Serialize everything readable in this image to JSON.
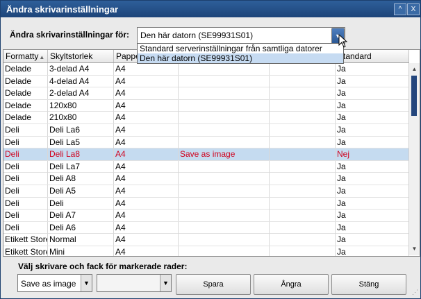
{
  "window": {
    "title": "Ändra skrivarinställningar"
  },
  "titlebar": {
    "minimize_glyph": "^",
    "close_glyph": "X"
  },
  "filter": {
    "label": "Ändra skrivarinställningar för:",
    "selected": "Den här datorn (SE99931S01)",
    "options": [
      "Standard serverinställningar från samtliga datorer",
      "Den här datorn (SE99931S01)"
    ]
  },
  "table": {
    "columns": [
      "Formatty",
      "Skyltstorlek",
      "Papper",
      "",
      "",
      "Standard"
    ],
    "sort_glyph": "▲",
    "rows": [
      [
        "Delade",
        "3-delad A4",
        "A4",
        "",
        "",
        "Ja"
      ],
      [
        "Delade",
        "4-delad A4",
        "A4",
        "",
        "",
        "Ja"
      ],
      [
        "Delade",
        "2-delad A4",
        "A4",
        "",
        "",
        "Ja"
      ],
      [
        "Delade",
        "120x80",
        "A4",
        "",
        "",
        "Ja"
      ],
      [
        "Delade",
        "210x80",
        "A4",
        "",
        "",
        "Ja"
      ],
      [
        "Deli",
        "Deli La6",
        "A4",
        "",
        "",
        "Ja"
      ],
      [
        "Deli",
        "Deli La5",
        "A4",
        "",
        "",
        "Ja"
      ],
      [
        "Deli",
        "Deli La8",
        "A4",
        "Save as image",
        "",
        "Nej"
      ],
      [
        "Deli",
        "Deli La7",
        "A4",
        "",
        "",
        "Ja"
      ],
      [
        "Deli",
        "Deli A8",
        "A4",
        "",
        "",
        "Ja"
      ],
      [
        "Deli",
        "Deli A5",
        "A4",
        "",
        "",
        "Ja"
      ],
      [
        "Deli",
        "Deli",
        "A4",
        "",
        "",
        "Ja"
      ],
      [
        "Deli",
        "Deli A7",
        "A4",
        "",
        "",
        "Ja"
      ],
      [
        "Deli",
        "Deli A6",
        "A4",
        "",
        "",
        "Ja"
      ],
      [
        "Etikett Store",
        "Normal",
        "A4",
        "",
        "",
        "Ja"
      ],
      [
        "Etikett Store",
        "Mini",
        "A4",
        "",
        "",
        "Ja"
      ]
    ],
    "selected_row": 7
  },
  "bottom": {
    "label": "Välj skrivare och fack för markerade rader:",
    "printer_value": "Save as image",
    "tray_value": "",
    "save_label": "Spara",
    "undo_label": "Ångra",
    "close_label": "Stäng"
  },
  "colors": {
    "title_bg": "#1d4479",
    "selected_row": "#c5dbf0",
    "selected_text": "#d0001c",
    "scroll_thumb": "#24467d"
  }
}
